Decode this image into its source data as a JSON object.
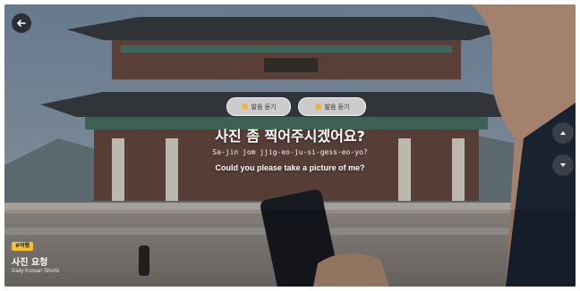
{
  "overlay": {
    "pills": [
      {
        "label": "발음 듣기",
        "icon": "sound-icon"
      },
      {
        "label": "발음 듣기",
        "icon": "sound-icon"
      }
    ],
    "korean": "사진 좀 찍어주시겠어요?",
    "romanization": "Sa-jin jom jjig-eo-ju-si-gess-eo-yo?",
    "english": "Could you please take a picture of me?"
  },
  "card": {
    "badge": "#여행",
    "title": "사진 요청",
    "subtitle": "Daily Korean Shorts"
  },
  "icons": {
    "back": "back-arrow-icon",
    "up": "chevron-up-icon",
    "down": "chevron-down-icon"
  },
  "colors": {
    "badge": "#f2c230",
    "button_dark": "#2b2f36"
  }
}
